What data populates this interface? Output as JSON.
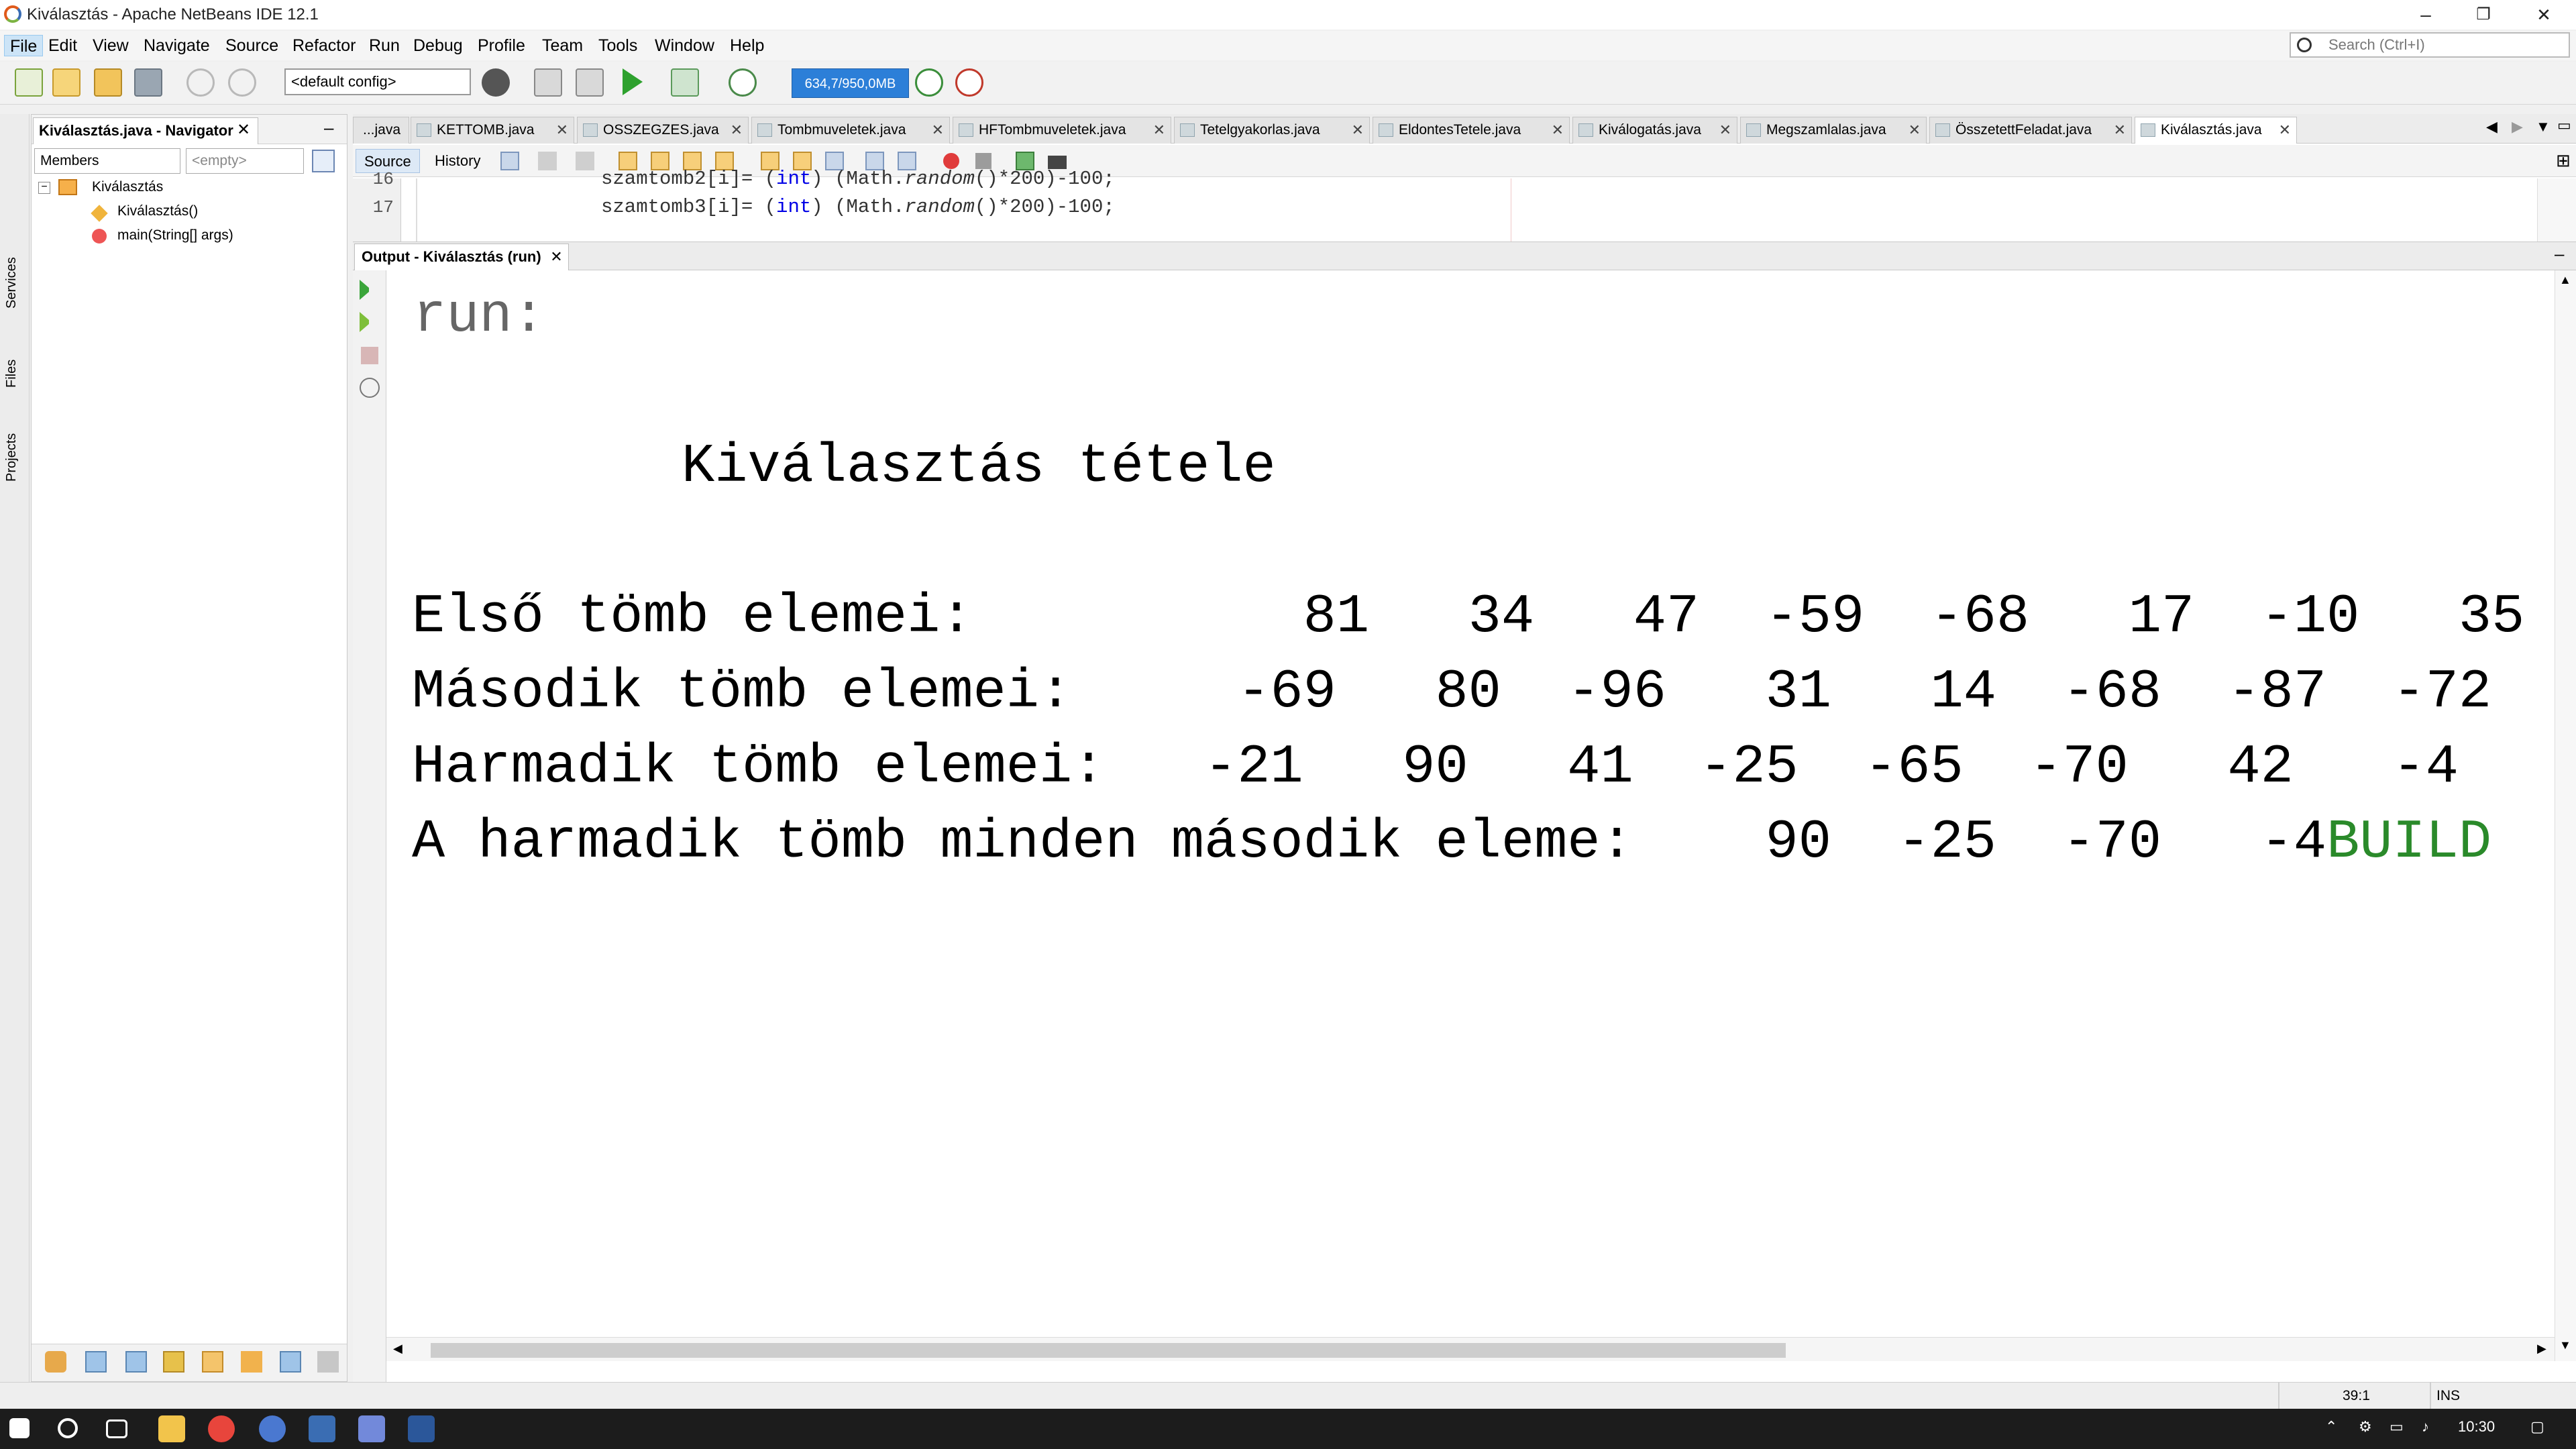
{
  "window": {
    "title": "Kiválasztás - Apache NetBeans IDE 12.1",
    "minimize": "–",
    "restore": "❐",
    "close": "✕"
  },
  "menu": [
    "File",
    "Edit",
    "View",
    "Navigate",
    "Source",
    "Refactor",
    "Run",
    "Debug",
    "Profile",
    "Team",
    "Tools",
    "Window",
    "Help"
  ],
  "search": {
    "placeholder": "Search (Ctrl+I)"
  },
  "toolbar": {
    "config": "<default config>",
    "memory": "634,7/950,0MB"
  },
  "left_strip": [
    "Services",
    "Files",
    "Projects"
  ],
  "navigator": {
    "title": "Kiválasztás.java - Navigator",
    "filter1": "Members",
    "filter2": "<empty>",
    "tree": {
      "root": "Kiválasztás",
      "children": [
        "Kiválasztás()",
        "main(String[] args)"
      ]
    }
  },
  "tabs": [
    "...java",
    "KETTOMB.java",
    "OSSZEGZES.java",
    "Tombmuveletek.java",
    "HFTombmuveletek.java",
    "Tetelgyakorlas.java",
    "EldontesTetele.java",
    "Kiválogatás.java",
    "Megszamlalas.java",
    "ÖsszetettFeladat.java",
    "Kiválasztás.java"
  ],
  "editor": {
    "source_tab": "Source",
    "history_tab": "History",
    "lines": [
      {
        "num": "16",
        "pre": "szamtomb2[i]= (",
        "kw": "int",
        "mid": ") (Math.",
        "it": "random",
        "post": "()*200)-100;"
      },
      {
        "num": "17",
        "pre": "szamtomb3[i]= (",
        "kw": "int",
        "mid": ") (Math.",
        "it": "random",
        "post": "()*200)-100;"
      }
    ]
  },
  "output": {
    "title": "Output - Kiválasztás (run)",
    "run": "run:",
    "heading": "Kiválasztás tétele",
    "rows": [
      "Első tömb elemei:          81   34   47  -59  -68   17  -10   35",
      "Második tömb elemei:     -69   80  -96   31   14  -68  -87  -72",
      "Harmadik tömb elemei:   -21   90   41  -25  -65  -70   42   -4",
      "A harmadik tömb minden második eleme:    90  -25  -70   -4"
    ],
    "build": "BUILD"
  },
  "status": {
    "position": "39:1",
    "mode": "INS"
  },
  "taskbar": {
    "time": "10:30"
  },
  "colors": {
    "accent": "#2c7fd8",
    "build": "#2a8a2a",
    "keyword": "#0000e6"
  }
}
